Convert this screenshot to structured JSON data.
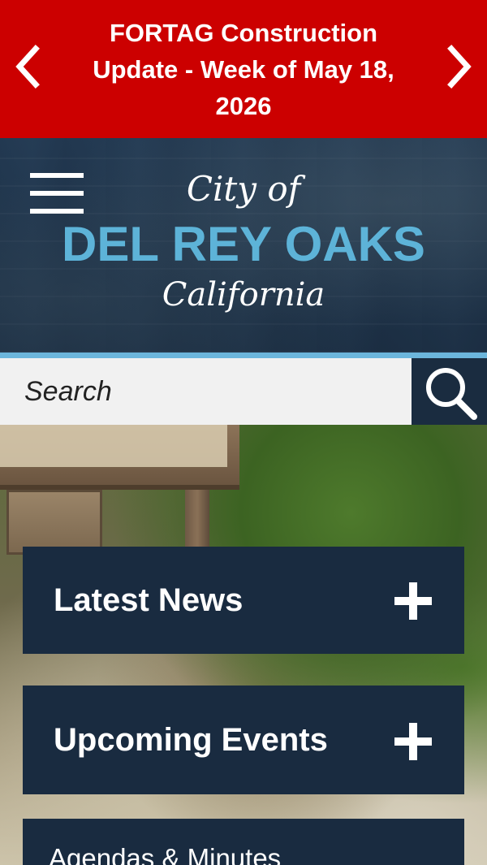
{
  "alert": {
    "text": "FORTAG Construction Update - Week of May 18, 2026",
    "prev_icon": "chevron-left-icon",
    "next_icon": "chevron-right-icon"
  },
  "header": {
    "logo_top": "City of",
    "logo_main": "DEL REY OAKS",
    "logo_bottom": "California",
    "menu_icon": "hamburger-menu-icon"
  },
  "search": {
    "placeholder": "Search",
    "icon": "search-icon"
  },
  "panels": [
    {
      "title": "Latest News",
      "icon": "plus-icon"
    },
    {
      "title": "Upcoming Events",
      "icon": "plus-icon"
    },
    {
      "title": "Agendas & Minutes"
    }
  ],
  "colors": {
    "alert_bg": "#cc0000",
    "header_accent": "#5db3d8",
    "panel_bg": "#192b40"
  }
}
